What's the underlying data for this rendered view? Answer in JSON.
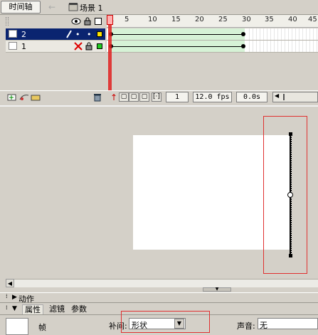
{
  "topbar": {
    "timeline_tab": "时间轴",
    "back_arrow": "←",
    "scene_label": "场景 1"
  },
  "timeline": {
    "ruler_numbers": [
      "1",
      "5",
      "10",
      "15",
      "20",
      "25",
      "30",
      "35",
      "40",
      "45"
    ],
    "layers": [
      {
        "name": "2",
        "selected": true
      },
      {
        "name": "1",
        "selected": false
      }
    ],
    "status": {
      "frame": "1",
      "fps": "12.0 fps",
      "time": "0.0s"
    }
  },
  "panels": {
    "actions_label": "动作",
    "tabs": [
      "属性",
      "滤镜",
      "参数"
    ],
    "frame_label": "帧",
    "tween_label": "补间:",
    "tween_value": "形状",
    "sound_label": "声音:",
    "sound_value": "无"
  },
  "colors": {
    "selection": "#0a2470",
    "tween": "#d6f2d6",
    "highlight": "#e03030"
  },
  "icons": [
    "eye-icon",
    "lock-icon",
    "outline-icon",
    "pencil-icon",
    "delete-icon",
    "trash-icon",
    "add-layer-icon",
    "scene-icon"
  ]
}
